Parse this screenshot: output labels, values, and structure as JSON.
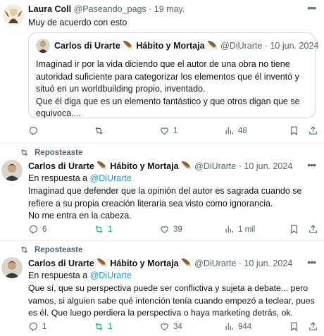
{
  "post1": {
    "author": "Laura Coll",
    "handle": "@Paseando_pags",
    "date": "· 19 may.",
    "text": "Muy de acuerdo con esto",
    "quote": {
      "author": "Carlos di Urarte",
      "pen1": "🪶",
      "suffix": "Hábito y Mortaja",
      "pen2": "🪶",
      "handle": "@DiUrarte",
      "date": "· 10 jun. 2024",
      "lines": [
        "Imaginad ir por la vida diciendo que el autor de una obra no tiene",
        "autoridad suficiente para categorizar los elementos que él inventó y",
        "situó en un worldbuilding propio, inventado.",
        "Que él diga que es un elemento fantástico y que otros digan que se",
        "equivoca...."
      ]
    },
    "actions": {
      "reply": "",
      "repost": "",
      "like": "1",
      "views": "48"
    }
  },
  "post2": {
    "reposted_label": "Reposteaste",
    "author": "Carlos di Urarte",
    "pen1": "🪶",
    "suffix": "Hábito y Mortaja",
    "pen2": "🪶",
    "handle": "@DiUrarte",
    "date": "· 10 jun. 2024",
    "reply_prefix": "En respuesta a",
    "reply_to": "@DiUrarte",
    "lines": [
      "Imaginad que defender que la opinión del autor es sagrada cuando se",
      "refiere a su propia creación literaria sea visto como ignorancia.",
      "No me entra en la cabeza."
    ],
    "actions": {
      "reply": "6",
      "repost": "1",
      "like": "39",
      "views": "1 mil"
    }
  },
  "post3": {
    "reposted_label": "Reposteaste",
    "author": "Carlos di Urarte",
    "pen1": "🪶",
    "suffix": "Hábito y Mortaja",
    "pen2": "🪶",
    "handle": "@DiUrarte",
    "date": "· 10 jun. 2024",
    "reply_prefix": "En respuesta a",
    "reply_to": "@DiUrarte",
    "lines": [
      "Que sí, que su perspectiva puede ser conflictiva y sujeta a debate... pero",
      "vamos, si alguien sabe qué intención tenía cuando empezó a teclear, pues",
      "es él. Que luego perdiera la perspectiva o haya marketing detrás, ok."
    ],
    "actions": {
      "reply": "1",
      "repost": "1",
      "like": "34",
      "views": "944"
    }
  },
  "colors": {
    "accent": "#1d9bf0",
    "repost_active": "#00ba7c",
    "muted": "#536471"
  },
  "icons": [
    "more-icon",
    "reply-icon",
    "repost-icon",
    "like-icon",
    "views-icon",
    "bookmark-icon",
    "share-icon"
  ]
}
